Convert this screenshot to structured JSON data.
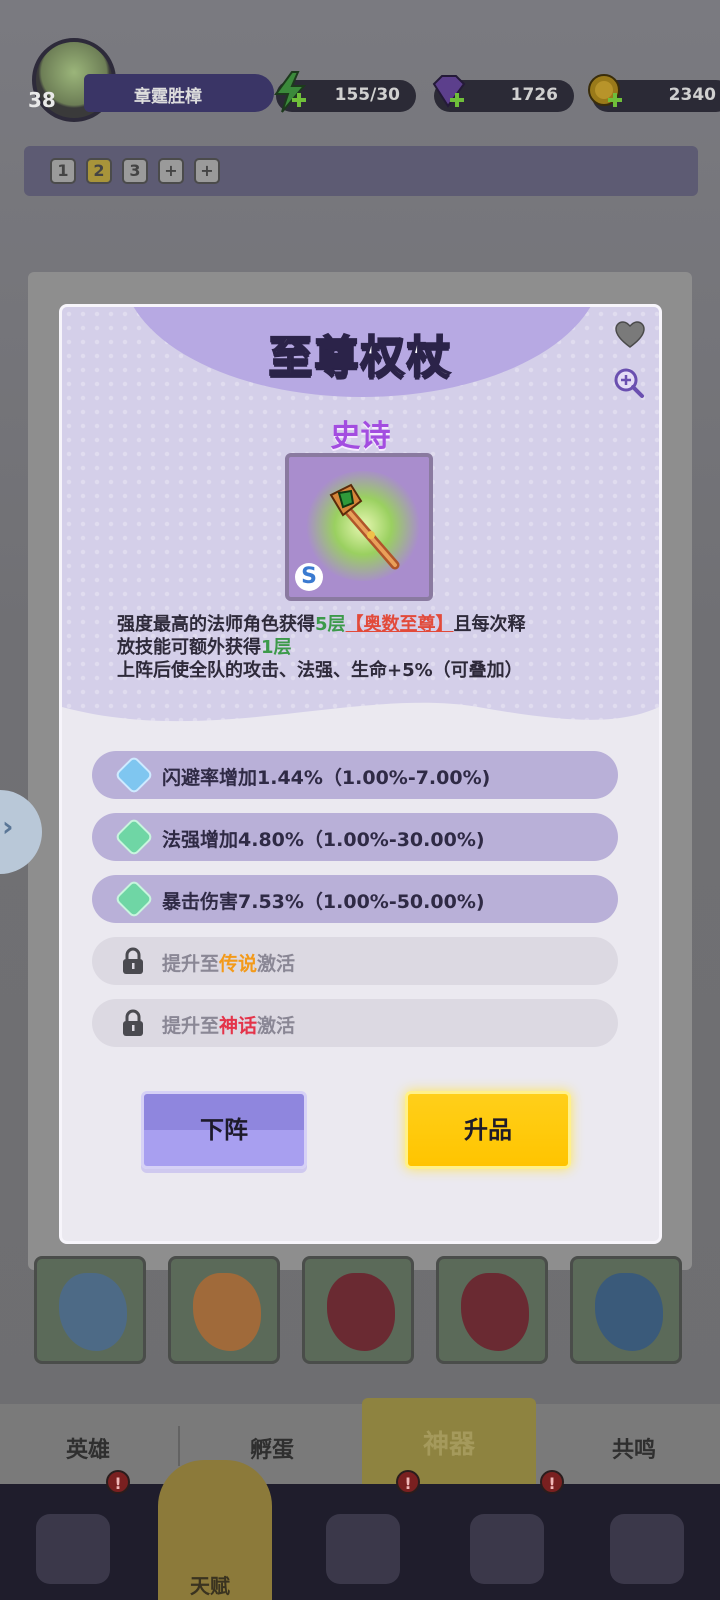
{
  "player": {
    "level": "38",
    "name": "章霆胜樟"
  },
  "resources": {
    "energy": "155/30",
    "gems": "1726",
    "gold": "2340"
  },
  "team_slots": [
    "1",
    "2",
    "3",
    "+",
    "+"
  ],
  "bottom_tabs": [
    {
      "label": "英雄"
    },
    {
      "label": "孵蛋"
    },
    {
      "label": "神器",
      "active": true
    },
    {
      "label": "共鸣"
    }
  ],
  "nav_badge": "!",
  "nav_active_label": "天赋",
  "popup": {
    "title": "至尊权杖",
    "rarity": "史诗",
    "grade": "S",
    "description": {
      "line1_a": "强度最高的法师角色获得",
      "line1_layers": "5层",
      "line1_buff": "【奥数至尊】",
      "line1_b": "且每次释",
      "line2_a": "放技能可额外获得",
      "line2_layers": "1层",
      "line3": "上阵后使全队的攻击、法强、生命+5%（可叠加）"
    },
    "stats": [
      {
        "text": "闪避率增加1.44%（1.00%-7.00%)",
        "gem_color": "#7fc6f0"
      },
      {
        "text": "法强增加4.80%（1.00%-30.00%)",
        "gem_color": "#6fd6a5"
      },
      {
        "text": "暴击伤害7.53%（1.00%-50.00%)",
        "gem_color": "#6fd6a5"
      }
    ],
    "locked_stats": [
      {
        "prefix": "提升至",
        "tier": "传说",
        "suffix": "激活"
      },
      {
        "prefix": "提升至",
        "tier": "神话",
        "suffix": "激活"
      }
    ],
    "buttons": {
      "unequip": "下阵",
      "upgrade": "升品"
    }
  },
  "colors": {
    "rarity": "#a34de0",
    "upgrade_button": "#ffc90a",
    "unequip_button": "#8f86de"
  }
}
